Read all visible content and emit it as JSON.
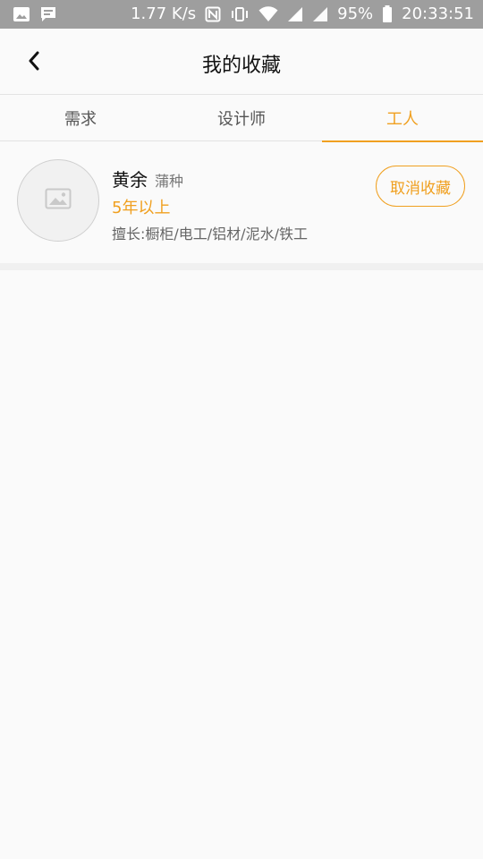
{
  "status_bar": {
    "speed": "1.77 K/s",
    "battery": "95%",
    "time": "20:33:51",
    "icons": [
      "image-icon",
      "message-icon",
      "nfc-icon",
      "vibrate-icon",
      "wifi-icon",
      "signal-icon",
      "signal-icon-2",
      "battery-icon"
    ]
  },
  "header": {
    "title": "我的收藏",
    "back_icon": "back-arrow-icon"
  },
  "tabs": [
    {
      "label": "需求",
      "active": false
    },
    {
      "label": "设计师",
      "active": false
    },
    {
      "label": "工人",
      "active": true
    }
  ],
  "favorites": [
    {
      "name": "黄余",
      "region": "蒲种",
      "experience": "5年以上",
      "skills": "擅长:橱柜/电工/铝材/泥水/铁工",
      "action_label": "取消收藏",
      "avatar_icon": "image-placeholder-icon"
    }
  ],
  "colors": {
    "accent": "#f0a020",
    "status_bar": "#9e9e9e",
    "background": "#fafafa"
  }
}
